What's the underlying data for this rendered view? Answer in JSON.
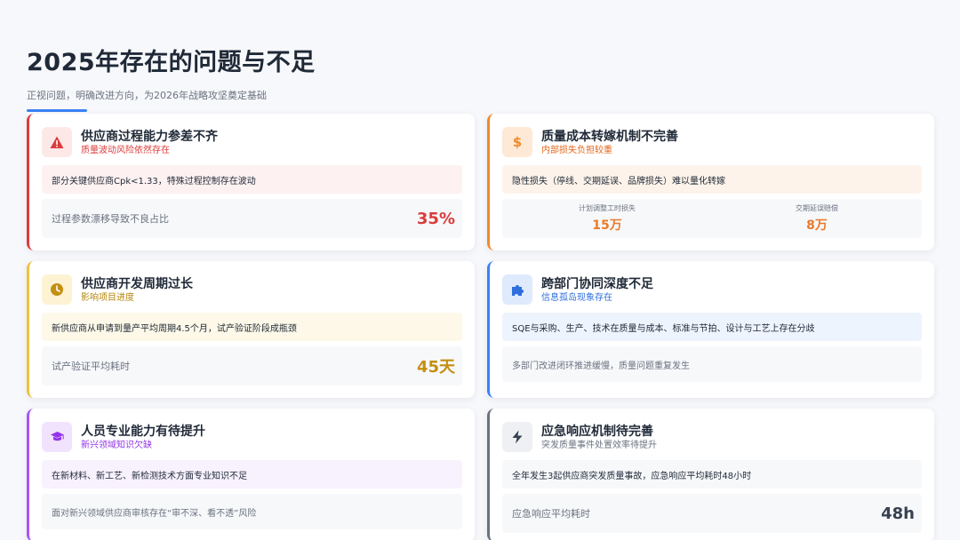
{
  "page": {
    "title": "2025年存在的问题与不足",
    "subtitle": "正视问题，明确改进方向，为2026年战略攻坚奠定基础"
  },
  "colors": {
    "accent": "#3b82f6",
    "red": "#dc3c3c",
    "orange": "#f08a2a",
    "yellow": "#f0c23a",
    "blue": "#3b82f6",
    "purple": "#a855f7",
    "gray": "#6b7280"
  },
  "cards": [
    {
      "icon": "warning-icon",
      "title": "供应商过程能力参差不齐",
      "tag": "质量波动风险依然存在",
      "desc": "部分关键供应商Cpk<1.33，特殊过程控制存在波动",
      "metric_label": "过程参数漂移导致不良占比",
      "metric_value": "35%"
    },
    {
      "icon": "dollar-icon",
      "title": "质量成本转嫁机制不完善",
      "tag": "内部损失负担较重",
      "desc": "隐性损失（停线、交期延误、品牌损失）难以量化转嫁",
      "metrics": [
        {
          "label": "计划调整工时损失",
          "value": "15万"
        },
        {
          "label": "交期延误赔偿",
          "value": "8万"
        }
      ]
    },
    {
      "icon": "clock-icon",
      "title": "供应商开发周期过长",
      "tag": "影响项目进度",
      "desc": "新供应商从申请到量产平均周期4.5个月，试产验证阶段成瓶颈",
      "metric_label": "试产验证平均耗时",
      "metric_value": "45天"
    },
    {
      "icon": "puzzle-icon",
      "title": "跨部门协同深度不足",
      "tag": "信息孤岛现象存在",
      "desc": "SQE与采购、生产、技术在质量与成本、标准与节拍、设计与工艺上存在分歧",
      "note": "多部门改进闭环推进缓慢，质量问题重复发生"
    },
    {
      "icon": "graduation-cap-icon",
      "title": "人员专业能力有待提升",
      "tag": "新兴领域知识欠缺",
      "desc": "在新材料、新工艺、新检测技术方面专业知识不足",
      "note": "面对新兴领域供应商审核存在“审不深、看不透”风险"
    },
    {
      "icon": "lightning-icon",
      "title": "应急响应机制待完善",
      "tag": "突发质量事件处置效率待提升",
      "desc": "全年发生3起供应商突发质量事故，应急响应平均耗时48小时",
      "metric_label": "应急响应平均耗时",
      "metric_value": "48h"
    }
  ]
}
